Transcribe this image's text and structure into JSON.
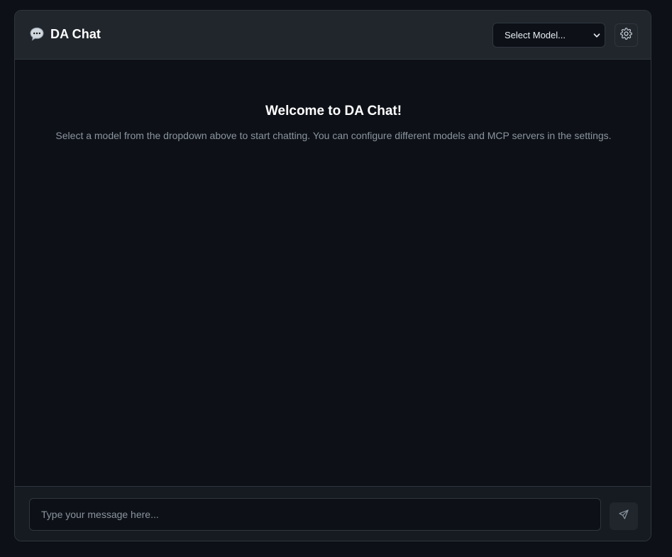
{
  "header": {
    "app_icon": "speech-bubble-icon",
    "title": "DA Chat",
    "model_select": {
      "selected_label": "Select Model...",
      "icon": "chevron-down-icon"
    },
    "settings_icon": "gear-icon"
  },
  "welcome": {
    "title": "Welcome to DA Chat!",
    "description": "Select a model from the dropdown above to start chatting. You can configure different models and MCP servers in the settings."
  },
  "composer": {
    "placeholder": "Type your message here...",
    "send_icon": "send-icon"
  },
  "colors": {
    "background": "#0d1117",
    "header_background": "#21262d",
    "border": "#30363d",
    "muted_text": "#8b949e",
    "primary_text": "#ffffff"
  }
}
